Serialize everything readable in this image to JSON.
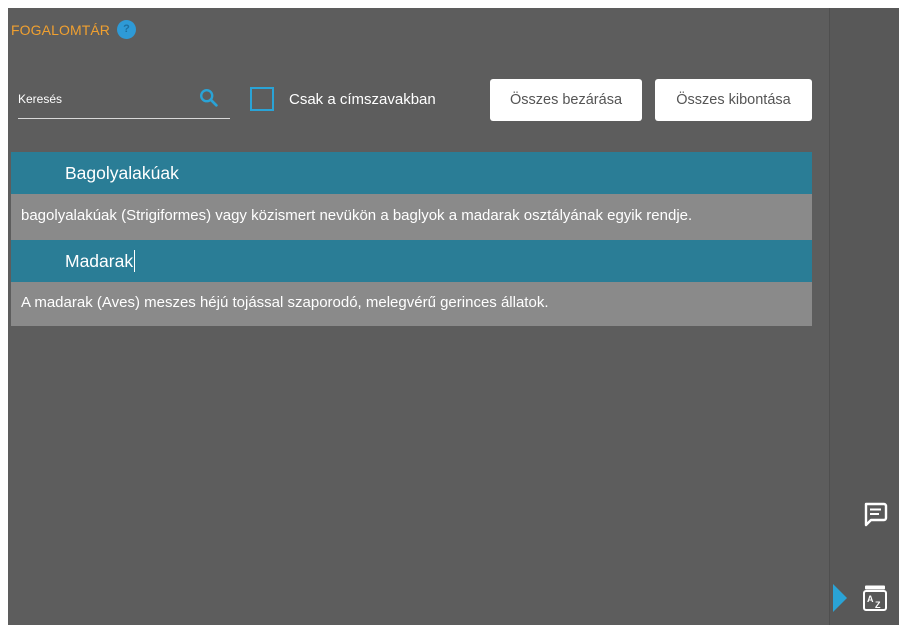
{
  "panel": {
    "title": "FOGALOMTÁR",
    "help_icon": "question-circle-icon"
  },
  "search": {
    "placeholder": "Keresés",
    "value": "",
    "icon": "search-icon"
  },
  "filter": {
    "checkbox_label": "Csak a címszavakban",
    "checked": false
  },
  "buttons": {
    "collapse_all": "Összes bezárása",
    "expand_all": "Összes kibontása"
  },
  "terms": [
    {
      "title": "Bagolyalakúak",
      "definition": "bagolyalakúak (Strigiformes) vagy közismert nevükön a baglyok a madarak osztályának egyik rendje."
    },
    {
      "title": "Madarak",
      "definition": "A madarak (Aves) meszes héjú tojással szaporodó, melegvérű gerinces állatok."
    }
  ],
  "sidebar": {
    "items": [
      {
        "icon": "comment-icon"
      },
      {
        "icon": "glossary-az-icon",
        "active": true
      }
    ]
  },
  "colors": {
    "title": "#f0a030",
    "accent": "#2aa3d6",
    "term_header": "#2a7d96",
    "term_body": "#8a8a8a",
    "background": "#5d5d5d"
  }
}
